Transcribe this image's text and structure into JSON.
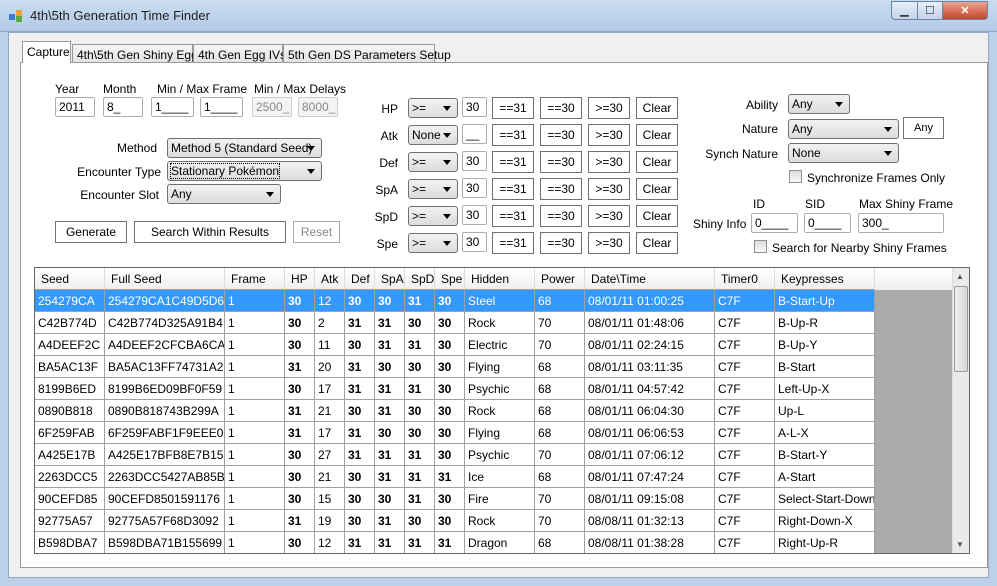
{
  "window": {
    "title": "4th\\5th Generation Time Finder"
  },
  "tabs": [
    "Capture",
    "4th\\5th Gen Shiny Egg",
    "4th Gen Egg IVs",
    "5th Gen DS Parameters Setup"
  ],
  "capture": {
    "year_label": "Year",
    "year": "2011",
    "month_label": "Month",
    "month": "8_",
    "frame_label": "Min / Max Frame",
    "min_frame": "1____",
    "max_frame": "1____",
    "delay_label": "Min / Max Delays",
    "min_delay": "2500_",
    "max_delay": "8000_",
    "method_label": "Method",
    "method": "Method 5 (Standard Seed)",
    "encounter_type_label": "Encounter Type",
    "encounter_type": "Stationary Pokémon",
    "encounter_slot_label": "Encounter Slot",
    "encounter_slot": "Any",
    "generate": "Generate",
    "search_within": "Search Within Results",
    "reset": "Reset"
  },
  "ivs": [
    {
      "stat": "HP",
      "op": ">=",
      "value": "30"
    },
    {
      "stat": "Atk",
      "op": "None",
      "value": "__"
    },
    {
      "stat": "Def",
      "op": ">=",
      "value": "30"
    },
    {
      "stat": "SpA",
      "op": ">=",
      "value": "30"
    },
    {
      "stat": "SpD",
      "op": ">=",
      "value": "30"
    },
    {
      "stat": "Spe",
      "op": ">=",
      "value": "30"
    }
  ],
  "iv_buttons": {
    "eq31": "==31",
    "eq30": "==30",
    "ge30": ">=30",
    "clear": "Clear"
  },
  "right": {
    "ability_label": "Ability",
    "ability": "Any",
    "nature_label": "Nature",
    "nature": "Any",
    "nature_button": "Any",
    "synch_label": "Synch Nature",
    "synch": "None",
    "sync_only": "Synchronize Frames Only",
    "shiny_label": "Shiny Info",
    "id_label": "ID",
    "id": "0____",
    "sid_label": "SID",
    "sid": "0____",
    "max_shiny_label": "Max Shiny Frame",
    "max_shiny": "300_",
    "nearby": "Search for Nearby Shiny Frames"
  },
  "grid": {
    "columns": [
      "Seed",
      "Full Seed",
      "Frame",
      "HP",
      "Atk",
      "Def",
      "SpA",
      "SpD",
      "Spe",
      "Hidden",
      "Power",
      "Date\\Time",
      "Timer0",
      "Keypresses"
    ],
    "selected_row": 0,
    "rows": [
      [
        "254279CA",
        "254279CA1C49D5D6",
        "1",
        "30",
        "12",
        "30",
        "30",
        "31",
        "30",
        "Steel",
        "68",
        "08/01/11 01:00:25",
        "C7F",
        "B-Start-Up"
      ],
      [
        "C42B774D",
        "C42B774D325A91B4",
        "1",
        "30",
        "2",
        "31",
        "31",
        "30",
        "30",
        "Rock",
        "70",
        "08/01/11 01:48:06",
        "C7F",
        "B-Up-R"
      ],
      [
        "A4DEEF2C",
        "A4DEEF2CFCBA6CA4",
        "1",
        "30",
        "11",
        "30",
        "31",
        "31",
        "30",
        "Electric",
        "70",
        "08/01/11 02:24:15",
        "C7F",
        "B-Up-Y"
      ],
      [
        "BA5AC13F",
        "BA5AC13FF74731A2",
        "1",
        "31",
        "20",
        "31",
        "30",
        "30",
        "30",
        "Flying",
        "68",
        "08/01/11 03:11:35",
        "C7F",
        "B-Start"
      ],
      [
        "8199B6ED",
        "8199B6ED09BF0F59",
        "1",
        "30",
        "17",
        "31",
        "31",
        "31",
        "30",
        "Psychic",
        "68",
        "08/01/11 04:57:42",
        "C7F",
        "Left-Up-X"
      ],
      [
        "0890B818",
        "0890B818743B299A",
        "1",
        "31",
        "21",
        "30",
        "31",
        "30",
        "30",
        "Rock",
        "68",
        "08/01/11 06:04:30",
        "C7F",
        "Up-L"
      ],
      [
        "6F259FAB",
        "6F259FABF1F9EEE0",
        "1",
        "31",
        "17",
        "31",
        "30",
        "30",
        "30",
        "Flying",
        "68",
        "08/01/11 06:06:53",
        "C7F",
        "A-L-X"
      ],
      [
        "A425E17B",
        "A425E17BFB8E7B15",
        "1",
        "30",
        "27",
        "31",
        "31",
        "31",
        "30",
        "Psychic",
        "70",
        "08/01/11 07:06:12",
        "C7F",
        "B-Start-Y"
      ],
      [
        "2263DCC5",
        "2263DCC5427AB85B",
        "1",
        "30",
        "21",
        "30",
        "31",
        "31",
        "31",
        "Ice",
        "68",
        "08/01/11 07:47:24",
        "C7F",
        "A-Start"
      ],
      [
        "90CEFD85",
        "90CEFD8501591176",
        "1",
        "30",
        "15",
        "30",
        "30",
        "31",
        "30",
        "Fire",
        "70",
        "08/01/11 09:15:08",
        "C7F",
        "Select-Start-Down"
      ],
      [
        "92775A57",
        "92775A57F68D3092",
        "1",
        "31",
        "19",
        "30",
        "31",
        "30",
        "30",
        "Rock",
        "70",
        "08/08/11 01:32:13",
        "C7F",
        "Right-Down-X"
      ],
      [
        "B598DBA7",
        "B598DBA71B155699",
        "1",
        "30",
        "12",
        "31",
        "31",
        "31",
        "31",
        "Dragon",
        "68",
        "08/08/11 01:38:28",
        "C7F",
        "Right-Up-R"
      ]
    ]
  },
  "colors": {
    "selection": "#3399ff"
  }
}
